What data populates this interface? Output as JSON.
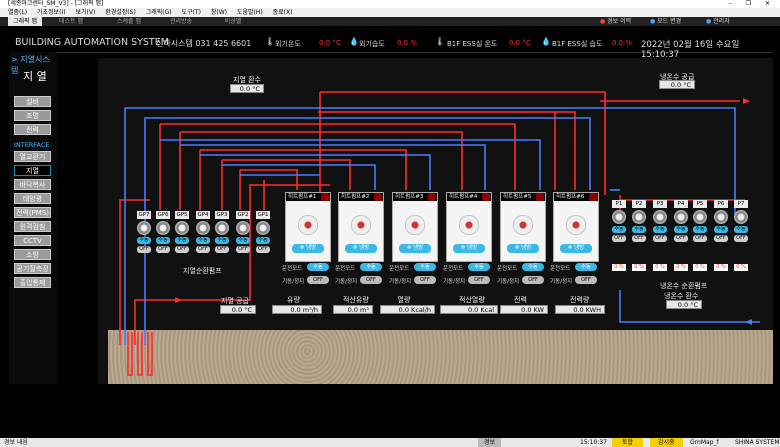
{
  "window": {
    "title": "[세종마크센터_SM_V3] - [그래픽 맵]",
    "controls": "– ❐ ✕"
  },
  "menu": [
    "열좀(L)",
    "기초정보(I)",
    "보기(V)",
    "환경설정(S)",
    "그래픽(G)",
    "도구(T)",
    "창(W)",
    "도움말(H)",
    "종료(X)"
  ],
  "tabs": [
    {
      "label": "그래픽 맵",
      "active": true
    },
    {
      "label": "데스트 맵",
      "active": false
    },
    {
      "label": "스케줄 맵",
      "active": false
    },
    {
      "label": "관리방송",
      "active": false
    },
    {
      "label": "비상벨",
      "active": false
    }
  ],
  "toolbar": {
    "alarm": "경보 이력",
    "mode": "모드 변경",
    "admin": "관리자"
  },
  "header": {
    "system": "BUILDING AUTOMATION SYSTEM",
    "company": "신아시스템 031 425 6601",
    "outdoor_temp_label": "외기온도",
    "outdoor_temp_value": "0.0 °C",
    "outdoor_hum_label": "외기습도",
    "outdoor_hum_value": "0.0 %",
    "ess_temp_label": "B1F ESS실 온도",
    "ess_temp_value": "0.0 °C",
    "ess_hum_label": "B1F ESS실 습도",
    "ess_hum_value": "0.0 %",
    "datetime": "2022년 02월 16일 수요일 15:10:37"
  },
  "sidebar": {
    "section": "지열시스템",
    "title": "지 열",
    "items": [
      "설비",
      "조명",
      "전력"
    ],
    "interface_label": "INTERFACE",
    "iface_items": [
      "열교환기",
      "지열",
      "바닥복사",
      "태양광",
      "전력(PMS)",
      "원격검침",
      "CCTV",
      "소방",
      "공기질측정",
      "출입통제"
    ],
    "active": "지열"
  },
  "geo": {
    "return_label": "지열 환수",
    "return_value": "0.0 °C",
    "supply_label": "지열 공급",
    "supply_value": "0.0 °C",
    "pump_group_label": "지열순환펌프",
    "pumps": [
      "GP7",
      "GP6",
      "GP5",
      "GP4",
      "GP3",
      "GP2",
      "GP1"
    ]
  },
  "cold": {
    "supply_label": "냉온수 공급",
    "supply_value": "0.0 °C",
    "return_title": "냉온수 순환펌프",
    "return_label": "냉온수 환수",
    "return_value": "0.0 °C",
    "pumps": [
      "P1",
      "P2",
      "P3",
      "P4",
      "P5",
      "P6",
      "P7"
    ],
    "pct": "0 %"
  },
  "pump_states": {
    "on": "수동",
    "off": "OFF"
  },
  "heatpumps": {
    "names": [
      "히트펌프#1",
      "히트펌프#2",
      "히트펌프#3",
      "히트펌프#4",
      "히트펌프#5",
      "히트펌프#6"
    ],
    "mode_btn": "냉방",
    "run_mode_label": "운전모드",
    "run_mode_value": "수동",
    "onoff_label": "기동/정지",
    "onoff_value": "OFF"
  },
  "metrics": [
    {
      "label": "유량",
      "value": "0.0 m³/h"
    },
    {
      "label": "적산유량",
      "value": "0.0 m³"
    },
    {
      "label": "열량",
      "value": "0.0 Kcal/h"
    },
    {
      "label": "적산열량",
      "value": "0.0 Kcal"
    },
    {
      "label": "전력",
      "value": "0.0 KW"
    },
    {
      "label": "전력량",
      "value": "0.0 KWH"
    }
  ],
  "status": {
    "left": "경보 내음",
    "alarm": "경보",
    "time": "15:10:37",
    "status1": "토합",
    "status2": "감시중",
    "map": "GrnMap_f",
    "brand": "SHINA SYSTEM"
  },
  "colors": {
    "hot": "#ff2b2b",
    "cold": "#4b7bff",
    "accent": "#3ab9e6"
  }
}
